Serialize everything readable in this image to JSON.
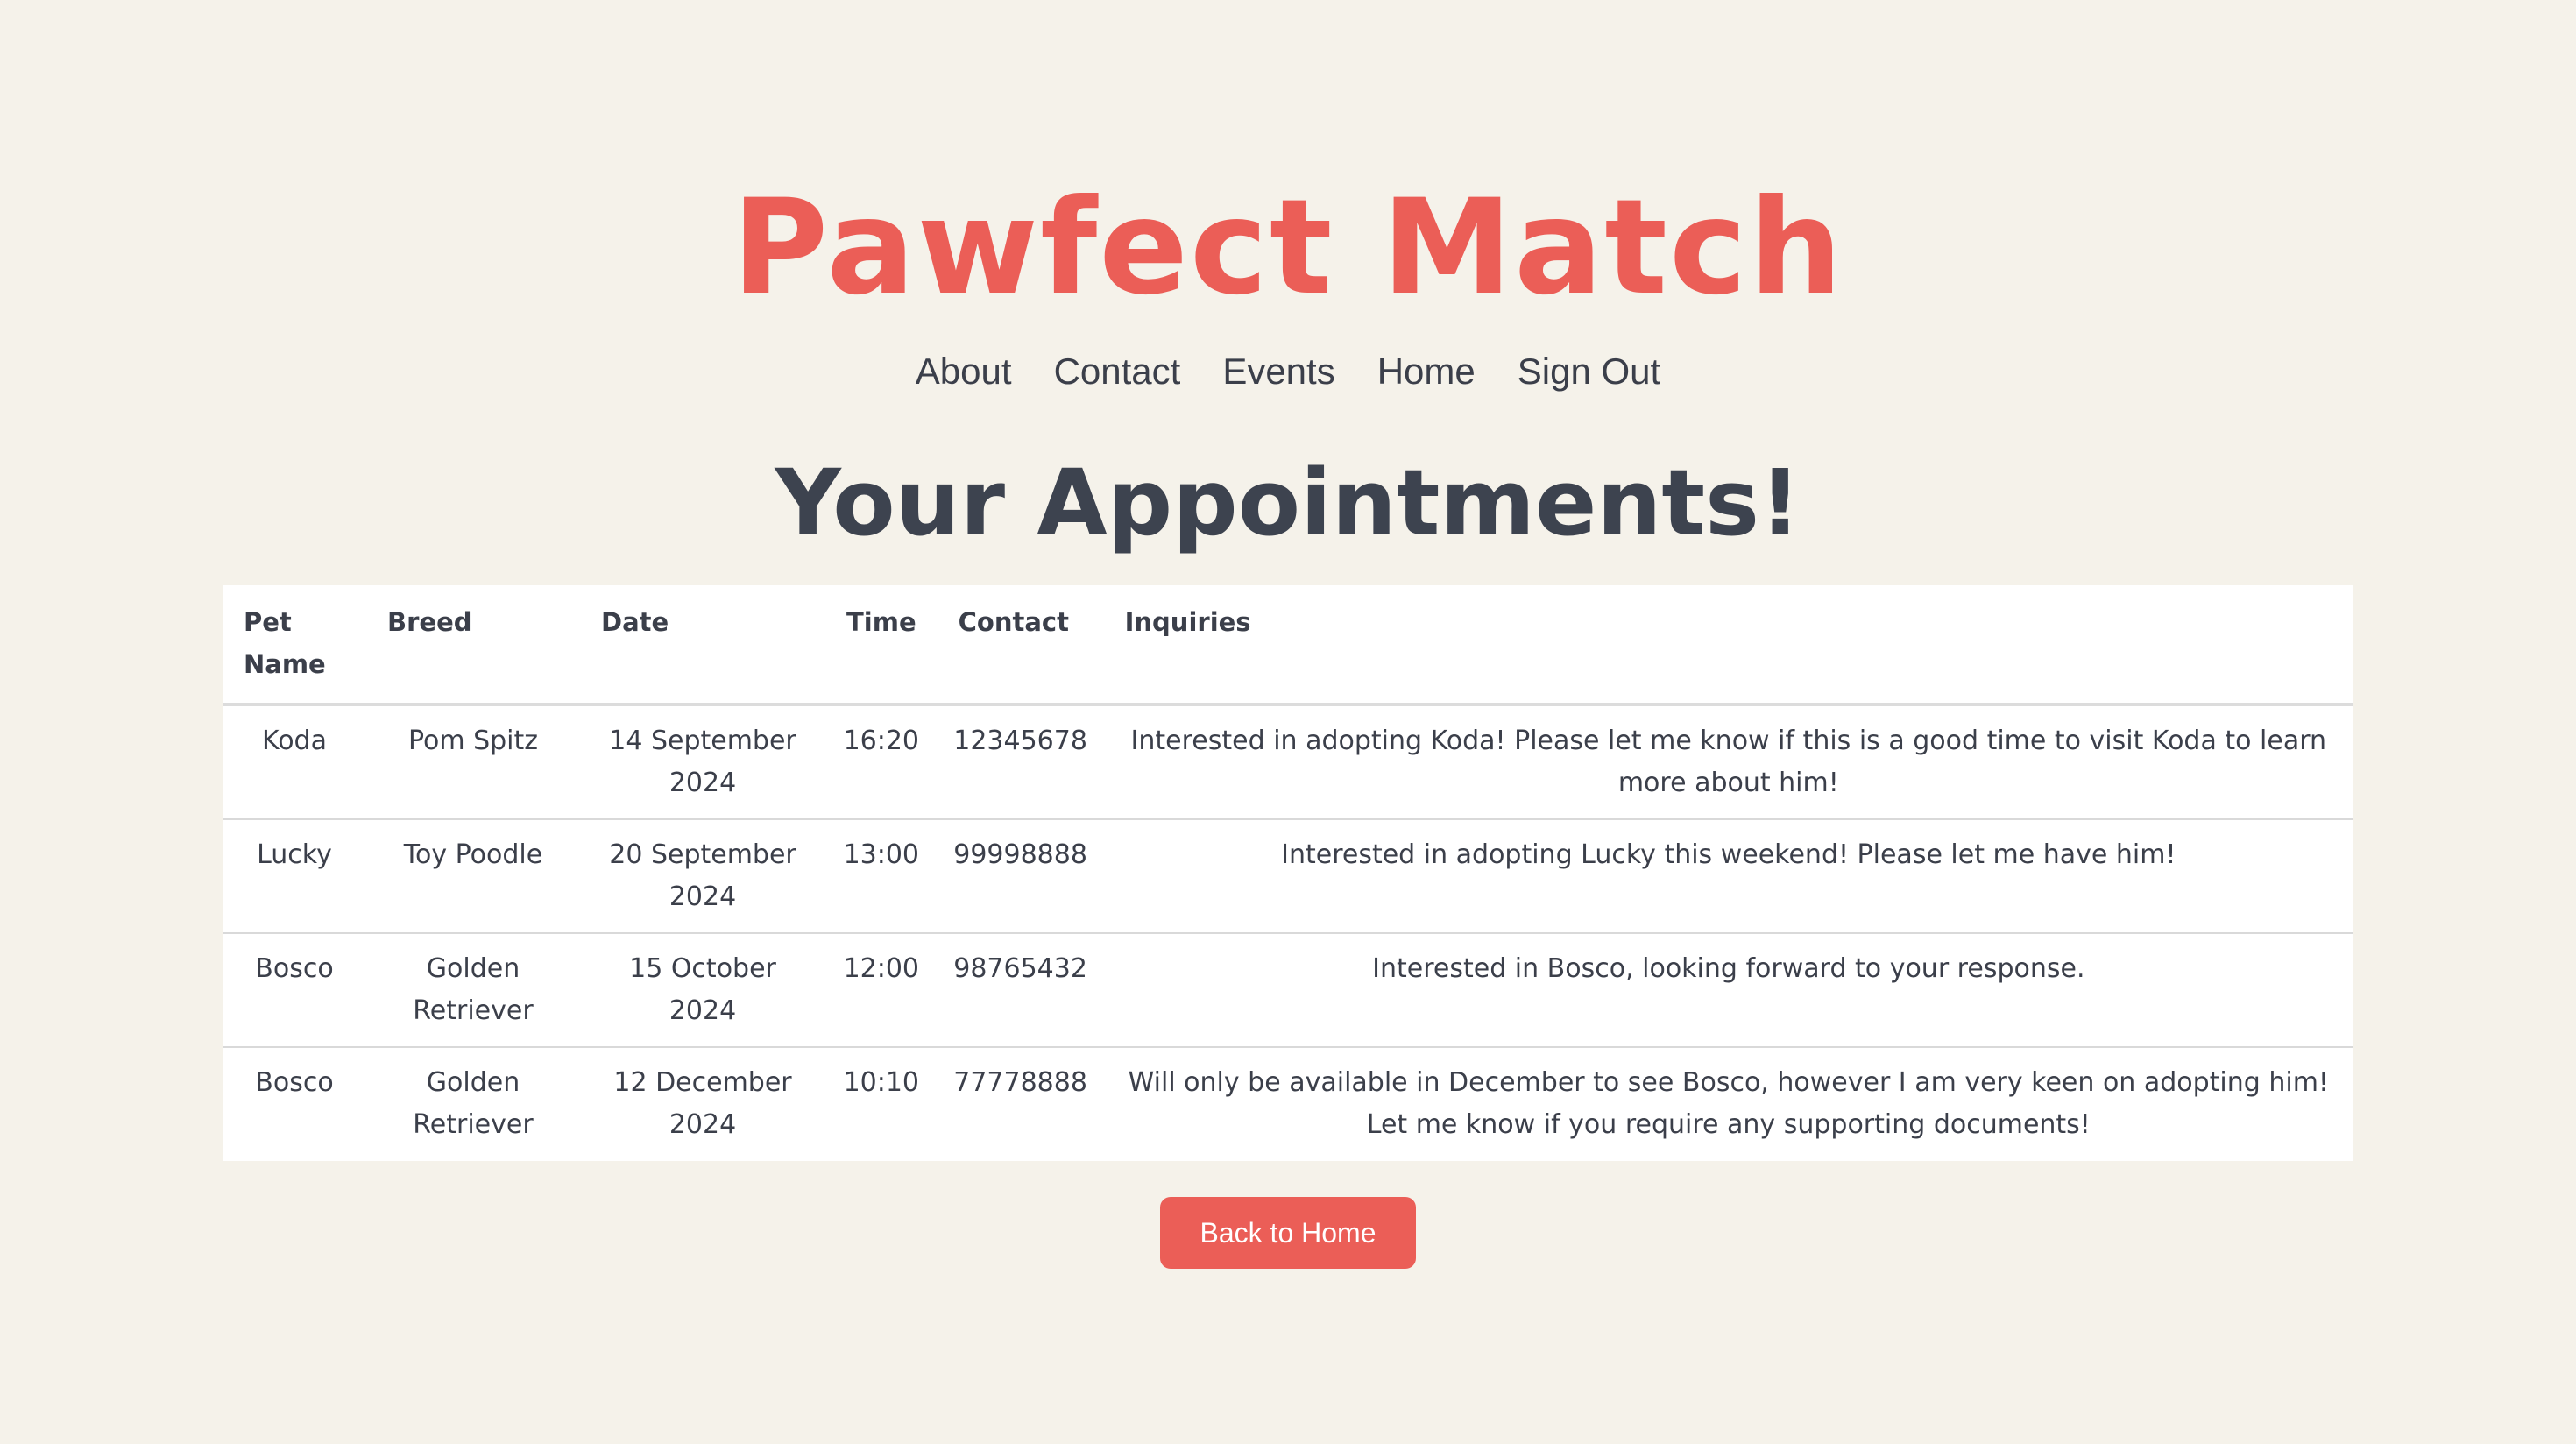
{
  "brand": {
    "title": "Pawfect Match",
    "color": "#eb5e57"
  },
  "nav": {
    "items": [
      {
        "label": "About"
      },
      {
        "label": "Contact"
      },
      {
        "label": "Events"
      },
      {
        "label": "Home"
      },
      {
        "label": "Sign Out"
      }
    ]
  },
  "main": {
    "title": "Your Appointments!",
    "table": {
      "headers": [
        "Pet Name",
        "Breed",
        "Date",
        "Time",
        "Contact",
        "Inquiries"
      ],
      "rows": [
        [
          "Koda",
          "Pom Spitz",
          "14 September 2024",
          "16:20",
          "12345678",
          "Interested in adopting Koda! Please let me know if this is a good time to visit Koda to learn more about him!"
        ],
        [
          "Lucky",
          "Toy Poodle",
          "20 September 2024",
          "13:00",
          "99998888",
          "Interested in adopting Lucky this weekend! Please let me have him!"
        ],
        [
          "Bosco",
          "Golden Retriever",
          "15 October 2024",
          "12:00",
          "98765432",
          "Interested in Bosco, looking forward to your response."
        ],
        [
          "Bosco",
          "Golden Retriever",
          "12 December 2024",
          "10:10",
          "77778888",
          "Will only be available in December to see Bosco, however I am very keen on adopting him! Let me know if you require any supporting documents!"
        ]
      ]
    },
    "back_button": {
      "label": "Back to Home",
      "color": "#eb5e57"
    }
  }
}
